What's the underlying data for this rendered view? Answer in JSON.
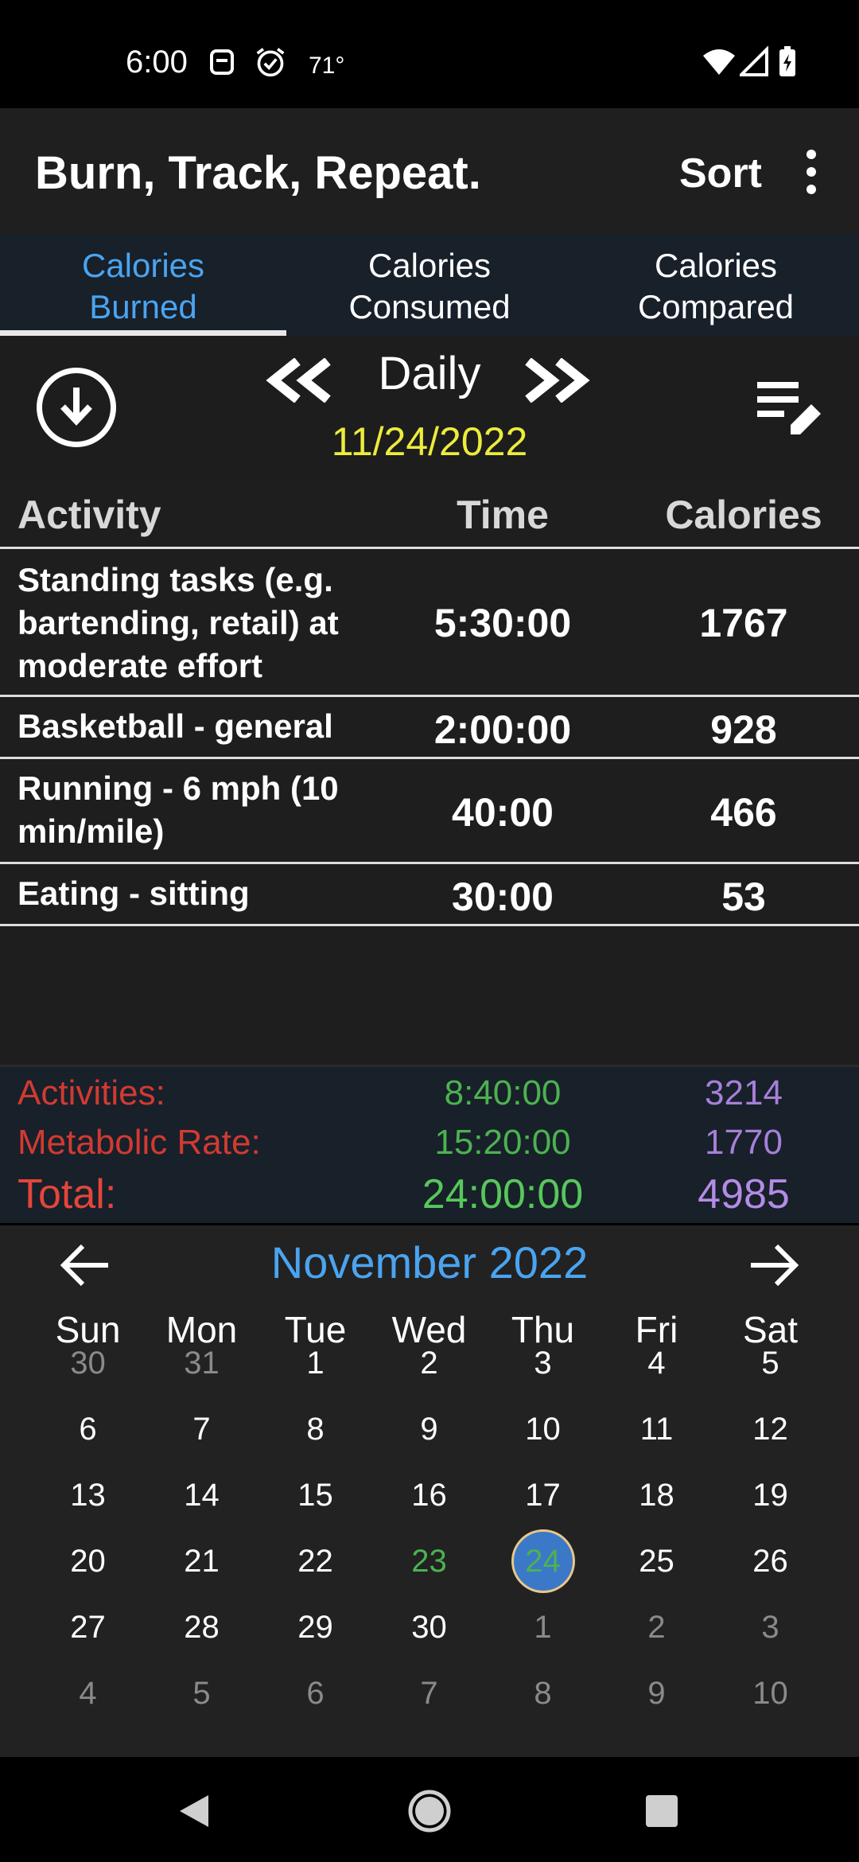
{
  "status_bar": {
    "time": "6:00",
    "temperature": "71°",
    "icons": [
      "notification-icon",
      "alarm-icon",
      "wifi-icon",
      "signal-icon",
      "battery-charging-icon"
    ]
  },
  "app_bar": {
    "title": "Burn, Track, Repeat.",
    "sort_label": "Sort",
    "overflow_icon": "more-vert-icon"
  },
  "tabs": [
    {
      "line1": "Calories",
      "line2": "Burned",
      "active": true
    },
    {
      "line1": "Calories",
      "line2": "Consumed",
      "active": false
    },
    {
      "line1": "Calories",
      "line2": "Compared",
      "active": false
    }
  ],
  "nav": {
    "period": "Daily",
    "date": "11/24/2022",
    "download_icon": "download-circle-icon",
    "prev_icon": "double-chevron-left-icon",
    "next_icon": "double-chevron-right-icon",
    "edit_icon": "edit-list-icon"
  },
  "table": {
    "headers": {
      "activity": "Activity",
      "time": "Time",
      "calories": "Calories"
    },
    "rows": [
      {
        "activity": "Standing tasks (e.g. bartending, retail) at moderate effort",
        "time": "5:30:00",
        "calories": "1767"
      },
      {
        "activity": "Basketball - general",
        "time": "2:00:00",
        "calories": "928"
      },
      {
        "activity": "Running - 6 mph (10 min/mile)",
        "time": "40:00",
        "calories": "466"
      },
      {
        "activity": "Eating - sitting",
        "time": "30:00",
        "calories": "53"
      }
    ]
  },
  "summary": {
    "activities": {
      "label": "Activities:",
      "time": "8:40:00",
      "calories": "3214"
    },
    "metabolic": {
      "label": "Metabolic Rate:",
      "time": "15:20:00",
      "calories": "1770"
    },
    "total": {
      "label": "Total:",
      "time": "24:00:00",
      "calories": "4985"
    }
  },
  "calendar": {
    "month_title": "November 2022",
    "prev_icon": "arrow-left-icon",
    "next_icon": "arrow-right-icon",
    "weekdays": [
      "Sun",
      "Mon",
      "Tue",
      "Wed",
      "Thu",
      "Fri",
      "Sat"
    ],
    "weeks": [
      [
        "30",
        "31",
        "1",
        "2",
        "3",
        "4",
        "5"
      ],
      [
        "6",
        "7",
        "8",
        "9",
        "10",
        "11",
        "12"
      ],
      [
        "13",
        "14",
        "15",
        "16",
        "17",
        "18",
        "19"
      ],
      [
        "20",
        "21",
        "22",
        "23",
        "24",
        "25",
        "26"
      ],
      [
        "27",
        "28",
        "29",
        "30",
        "1",
        "2",
        "3"
      ],
      [
        "4",
        "5",
        "6",
        "7",
        "8",
        "9",
        "10"
      ]
    ],
    "today": "23",
    "selected": "24",
    "colors": {
      "accent": "#4aa4f0",
      "today": "#4cb250",
      "selected_bg": "#3c78c8"
    }
  },
  "nav_bar": {
    "icons": [
      "back-triangle-icon",
      "home-circle-icon",
      "recents-square-icon"
    ]
  }
}
